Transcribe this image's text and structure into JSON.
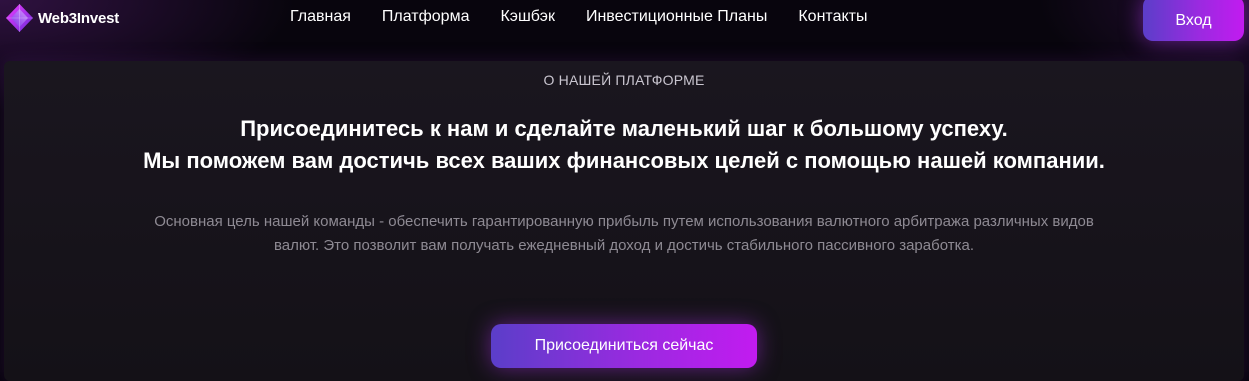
{
  "header": {
    "logo_text": "Web3Invest",
    "nav": [
      {
        "label": "Главная"
      },
      {
        "label": "Платформа"
      },
      {
        "label": "Кэшбэк"
      },
      {
        "label": "Инвестиционные Планы"
      },
      {
        "label": "Контакты"
      }
    ],
    "login_label": "Вход"
  },
  "about": {
    "eyebrow": "О НАШЕЙ ПЛАТФОРМЕ",
    "headline_line1": "Присоединитесь к нам и сделайте маленький шаг к большому успеху.",
    "headline_line2": "Мы поможем вам достичь всех ваших финансовых целей с помощью нашей компании.",
    "description": "Основная цель нашей команды - обеспечить гарантированную прибыль путем использования валютного арбитража различных видов валют. Это позволит вам получать ежедневный доход и достичь стабильного пассивного заработка.",
    "cta_label": "Присоединиться сейчас"
  },
  "colors": {
    "accent_start": "#5b3ec9",
    "accent_end": "#c21bf0",
    "background": "#08050d",
    "card": "#17131b"
  }
}
